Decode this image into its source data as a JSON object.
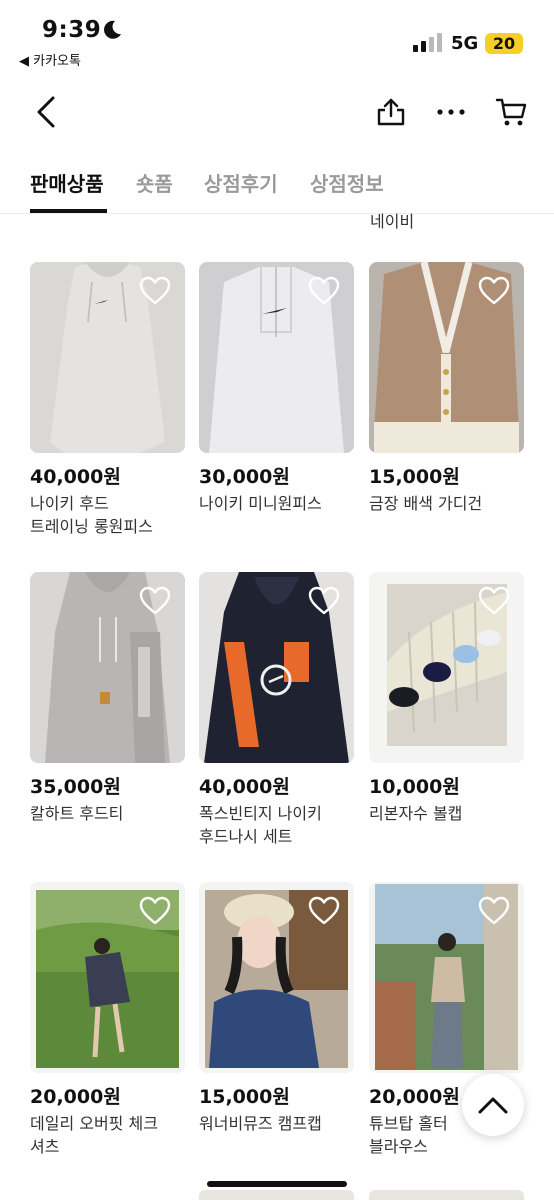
{
  "status": {
    "time": "9:39",
    "back_app": "◀ 카카오톡",
    "network": "5G",
    "battery": "20",
    "battery_color": "#f5cf28"
  },
  "nav": {
    "back_icon": "chevron-left-icon",
    "share_icon": "share-icon",
    "more_icon": "more-icon",
    "cart_icon": "cart-icon"
  },
  "tabs": [
    {
      "label": "판매상품",
      "active": true
    },
    {
      "label": "숏폼",
      "active": false
    },
    {
      "label": "상점후기",
      "active": false
    },
    {
      "label": "상점정보",
      "active": false
    }
  ],
  "peek_text": "네이비",
  "products": [
    {
      "price": "40,000원",
      "title": "나이키 후드\n트레이닝 롱원피스"
    },
    {
      "price": "30,000원",
      "title": "나이키 미니원피스"
    },
    {
      "price": "15,000원",
      "title": "금장 배색 가디건"
    },
    {
      "price": "35,000원",
      "title": "칼하트 후드티"
    },
    {
      "price": "40,000원",
      "title": "폭스빈티지 나이키\n후드나시 세트"
    },
    {
      "price": "10,000원",
      "title": "리본자수 볼캡"
    },
    {
      "price": "20,000원",
      "title": "데일리 오버핏 체크\n셔츠"
    },
    {
      "price": "15,000원",
      "title": "워너비뮤즈 캠프캡"
    },
    {
      "price": "20,000원",
      "title": "튜브탑 홀터\n블라우스"
    }
  ],
  "scroll_top_icon": "chevron-up-icon",
  "heart_icon": "heart-outline-icon"
}
